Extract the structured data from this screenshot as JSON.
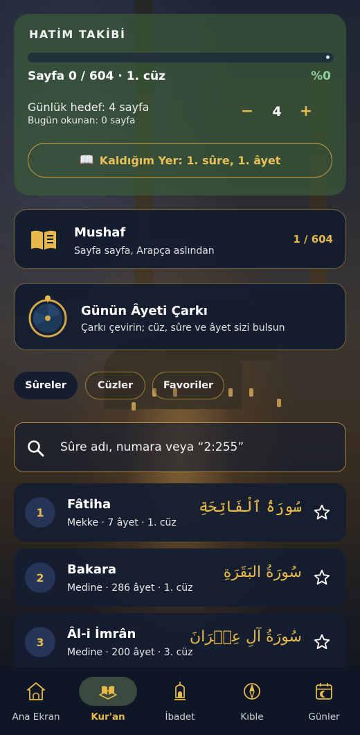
{
  "hatim": {
    "title": "HATİM TAKİBİ",
    "page_info": "Sayfa 0 / 604 · 1. cüz",
    "percent": "%0",
    "progress_fraction": 0,
    "goal_label": "Günlük hedef: 4 sayfa",
    "read_today": "Bugün okunan: 0 sayfa",
    "minus_label": "−",
    "plus_label": "+",
    "goal_value": "4",
    "resume_label": "Kaldığım Yer: 1. sûre, 1. âyet",
    "resume_emoji": "📖"
  },
  "mushaf": {
    "title": "Mushaf",
    "subtitle": "Sayfa sayfa, Arapça aslından",
    "count": "1 / 604"
  },
  "wheel": {
    "title": "Günün Âyeti Çarkı",
    "subtitle": "Çarkı çevirin; cüz, sûre ve âyet sizi bulsun"
  },
  "tabs": [
    {
      "label": "Sûreler",
      "active": true
    },
    {
      "label": "Cüzler",
      "active": false
    },
    {
      "label": "Favoriler",
      "active": false
    }
  ],
  "search": {
    "placeholder": "Sûre adı, numara veya “2:255”"
  },
  "surahs": [
    {
      "number": "1",
      "name": "Fâtiha",
      "meta": "Mekke · 7 âyet · 1. cüz",
      "arabic": "سُورَةُ ٱلْفَاتِحَةِ"
    },
    {
      "number": "2",
      "name": "Bakara",
      "meta": "Medine · 286 âyet · 1. cüz",
      "arabic": "سُورَةُ البَقَرَةِ"
    },
    {
      "number": "3",
      "name": "Âl-i İmrân",
      "meta": "Medine · 200 âyet · 3. cüz",
      "arabic": "سُورَةُ آلِ عِمۡرَانَ"
    }
  ],
  "nav": [
    {
      "label": "Ana Ekran",
      "icon": "home-mosque-icon",
      "active": false
    },
    {
      "label": "Kur'an",
      "icon": "quran-book-icon",
      "active": true
    },
    {
      "label": "İbadet",
      "icon": "lantern-icon",
      "active": false
    },
    {
      "label": "Kıble",
      "icon": "compass-icon",
      "active": false
    },
    {
      "label": "Günler",
      "icon": "calendar-icon",
      "active": false
    }
  ],
  "colors": {
    "accent_gold": "#e6b94a",
    "card_bg": "#121c30",
    "hatim_green": "#3a5a37",
    "percent_green": "#8fd0a0"
  }
}
